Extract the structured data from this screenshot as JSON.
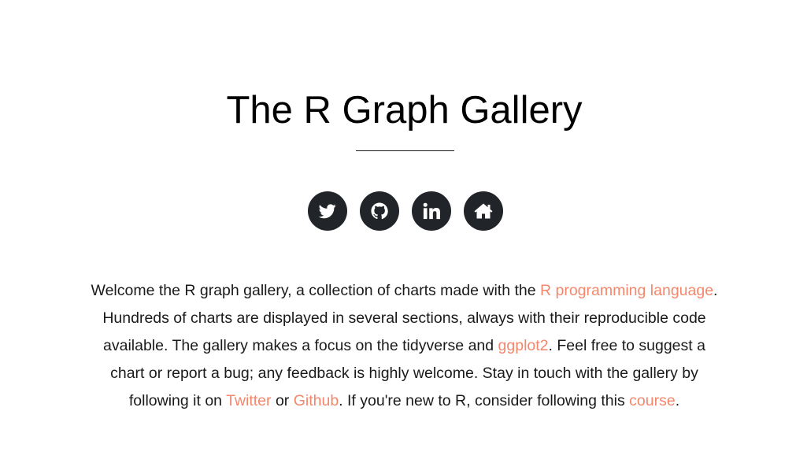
{
  "header": {
    "title": "The R Graph Gallery"
  },
  "social": {
    "buttons": [
      {
        "icon": "twitter-icon"
      },
      {
        "icon": "github-icon"
      },
      {
        "icon": "linkedin-icon"
      },
      {
        "icon": "home-icon"
      }
    ],
    "button_color": "#212529"
  },
  "intro": {
    "text_before_link1": "Welcome the R graph gallery, a collection of charts made with the ",
    "link1": "R programming language",
    "text_after_link1": ". Hundreds of charts are displayed in several sections, always with their reproducible code available. The gallery makes a focus on the tidyverse and ",
    "link2": "ggplot2",
    "text_after_link2": ". Feel free to suggest a chart or report a bug; any feedback is highly welcome. Stay in touch with the gallery by following it on ",
    "link3": "Twitter",
    "text_between": " or ",
    "link4": "Github",
    "text_after_link4": ". If you're new to R, consider following this ",
    "link5": "course",
    "text_end": ".",
    "link_color": "#f4876b"
  }
}
